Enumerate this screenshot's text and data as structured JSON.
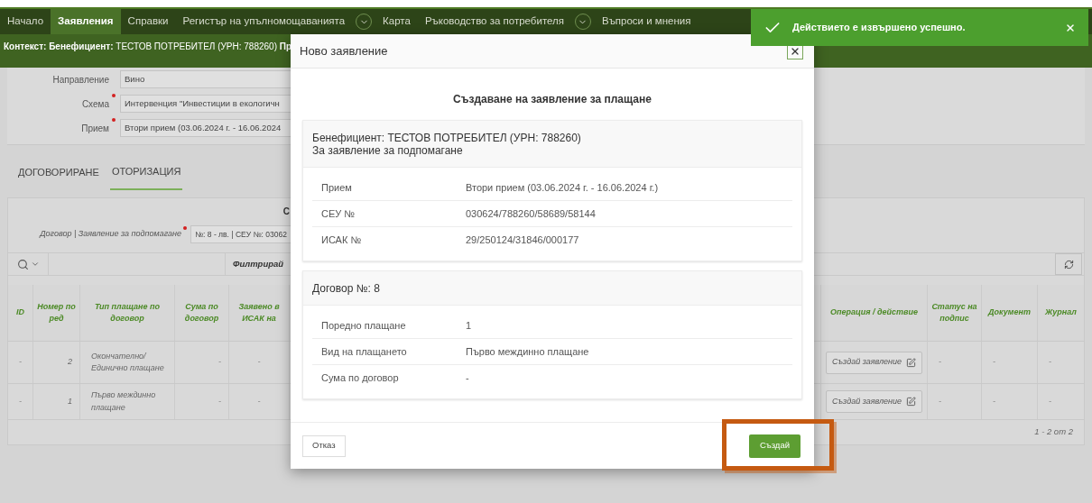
{
  "nav": {
    "items": [
      {
        "label": "Начало",
        "selected": false,
        "has_dropdown": false
      },
      {
        "label": "Заявления",
        "selected": true,
        "has_dropdown": false
      },
      {
        "label": "Справки",
        "selected": false,
        "has_dropdown": false
      },
      {
        "label": "Регистър на упълномощаванията",
        "selected": false,
        "has_dropdown": true
      },
      {
        "label": "Карта",
        "selected": false,
        "has_dropdown": false
      },
      {
        "label": "Ръководство за потребителя",
        "selected": false,
        "has_dropdown": true
      },
      {
        "label": "Въпроси и мнения",
        "selected": false,
        "has_dropdown": false
      }
    ]
  },
  "context_bar": {
    "text": "**Контекст: Бенефициент:** ТЕСТОВ ПОТРЕБИТЕЛ (УРН: 788260) **Пр**"
  },
  "form": {
    "fields": [
      {
        "label": "Направление",
        "value": "Вино",
        "required": false
      },
      {
        "label": "Схема",
        "value": "Интервенция \"Инвестиции в екологичн",
        "required": true
      },
      {
        "label": "Прием",
        "value": "Втори прием (03.06.2024 г. - 16.06.2024",
        "required": true
      }
    ]
  },
  "tabs": [
    {
      "label": "ДОГОВОРИРАНЕ",
      "selected": false
    },
    {
      "label": "ОТОРИЗАЦИЯ",
      "selected": true
    }
  ],
  "filter": {
    "heading_fragment": "С",
    "contract_label": "Договор | Заявление за подпомагане",
    "contract_required": true,
    "contract_value": "№: 8 - лв. | СЕУ №: 03062",
    "filter_button": "Филтрирай"
  },
  "table": {
    "columns_left": [
      "ID",
      "Номер по ред",
      "Тип плащане по договор",
      "Сума по договор",
      "Заявено в ИСАК на"
    ],
    "columns_right": [
      "Операция / действие",
      "Статус на подпис",
      "Документ",
      "Журнал"
    ],
    "rows": [
      {
        "id": "-",
        "number": "2",
        "type": "Окончателно/ Единично плащане",
        "amount": "-",
        "isak": "-",
        "action": "Създай заявление",
        "sign_status": "-",
        "document": "-",
        "log": "-"
      },
      {
        "id": "-",
        "number": "1",
        "type": "Първо междинно плащане",
        "amount": "-",
        "isak": "-",
        "action": "Създай заявление",
        "sign_status": "-",
        "document": "-",
        "log": "-"
      }
    ],
    "footer": "1 - 2 от 2"
  },
  "modal": {
    "title": "Ново заявление",
    "heading": "Създаване на заявление за плащане",
    "sections": [
      {
        "header_lines": [
          "Бенефициент: ТЕСТОВ ПОТРЕБИТЕЛ (УРН: 788260)",
          "За заявление за подпомагане"
        ],
        "rows": [
          {
            "label": "Прием",
            "value": "Втори прием (03.06.2024 г. - 16.06.2024 г.)"
          },
          {
            "label": "СЕУ №",
            "value": "030624/788260/58689/58144"
          },
          {
            "label": "ИСАК №",
            "value": "29/250124/31846/000177"
          }
        ]
      },
      {
        "header_lines": [
          "Договор №: 8"
        ],
        "rows": [
          {
            "label": "Поредно плащане",
            "value": "1"
          },
          {
            "label": "Вид на плащането",
            "value": "Първо междинно плащане"
          },
          {
            "label": "Сума по договор",
            "value": "-"
          }
        ]
      }
    ],
    "cancel_button": "Отказ",
    "confirm_button": "Създай",
    "confirm_highlighted": true
  },
  "toast": {
    "message": "Действието е извършено успешно."
  }
}
